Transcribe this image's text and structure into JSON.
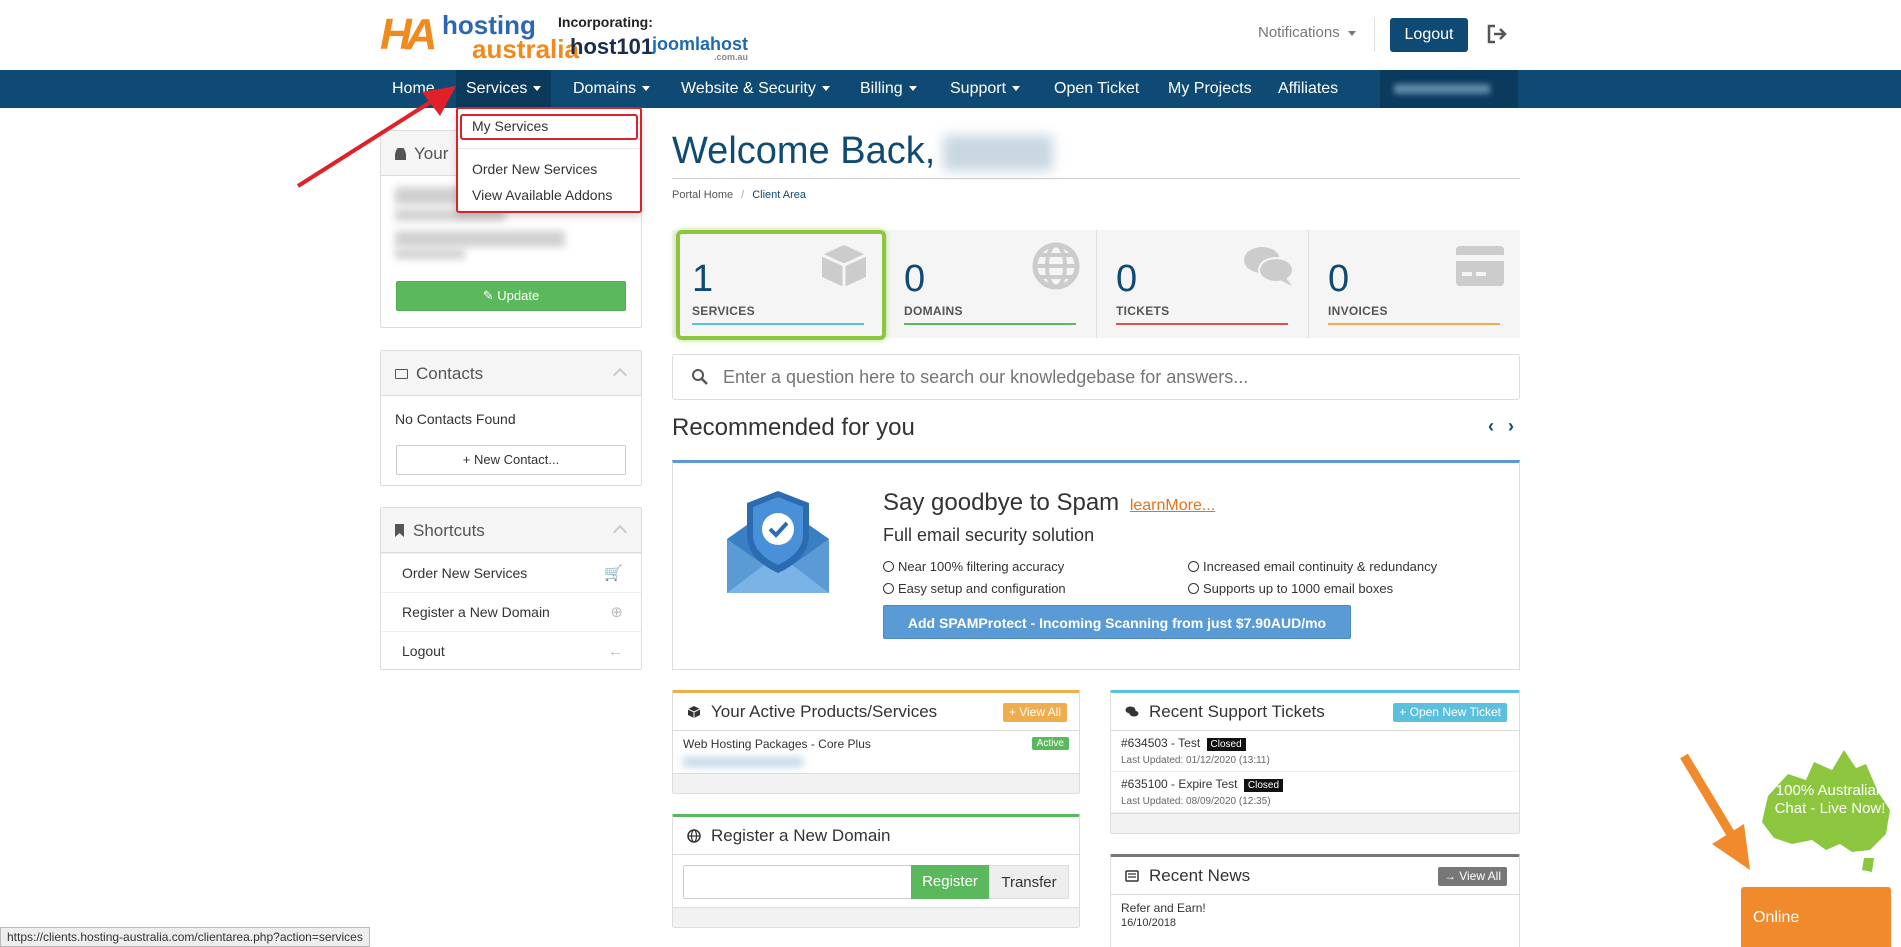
{
  "header": {
    "logo": {
      "ha": "HA",
      "hosting": "hosting",
      "australia": "australia",
      "incorporating": "Incorporating:",
      "host101": "host101",
      "joomlahost": "joomlahost",
      "joomla_suffix": ".com.au"
    },
    "notifications_label": "Notifications",
    "logout_label": "Logout"
  },
  "nav": {
    "items": [
      {
        "label": "Home"
      },
      {
        "label": "Services"
      },
      {
        "label": "Domains"
      },
      {
        "label": "Website & Security"
      },
      {
        "label": "Billing"
      },
      {
        "label": "Support"
      },
      {
        "label": "Open Ticket"
      },
      {
        "label": "My Projects"
      },
      {
        "label": "Affiliates"
      }
    ]
  },
  "services_dropdown": {
    "items": [
      {
        "label": "My Services"
      },
      {
        "label": "Order New Services"
      },
      {
        "label": "View Available Addons"
      }
    ]
  },
  "sidebar": {
    "your_info_title": "Your",
    "update_label": "Update",
    "contacts_title": "Contacts",
    "no_contacts": "No Contacts Found",
    "new_contact_label": "+ New Contact...",
    "shortcuts_title": "Shortcuts",
    "shortcuts": [
      {
        "label": "Order New Services",
        "icon": "cart-icon"
      },
      {
        "label": "Register a New Domain",
        "icon": "globe-icon"
      },
      {
        "label": "Logout",
        "icon": "arrow-left-icon"
      }
    ]
  },
  "main": {
    "welcome": "Welcome Back,",
    "breadcrumb": {
      "home": "Portal Home",
      "separator": "/",
      "current": "Client Area"
    },
    "tiles": [
      {
        "value": "1",
        "label": "SERVICES",
        "color": "#5bc0de",
        "icon": "cube-icon"
      },
      {
        "value": "0",
        "label": "DOMAINS",
        "color": "#5cb85c",
        "icon": "globe-icon"
      },
      {
        "value": "0",
        "label": "TICKETS",
        "color": "#d9534f",
        "icon": "comments-icon"
      },
      {
        "value": "0",
        "label": "INVOICES",
        "color": "#f0ad4e",
        "icon": "credit-card-icon"
      }
    ],
    "search_placeholder": "Enter a question here to search our knowledgebase for answers...",
    "recommended_title": "Recommended for you",
    "promo": {
      "title": "Say goodbye to Spam",
      "learn_more": "learnMore...",
      "subtitle": "Full email security solution",
      "features": [
        "Near 100% filtering accuracy",
        "Increased email continuity & redundancy",
        "Easy setup and configuration",
        "Supports up to 1000 email boxes"
      ],
      "button": "Add SPAMProtect - Incoming Scanning from just $7.90AUD/mo"
    },
    "products_panel": {
      "title": "Your Active Products/Services",
      "button": "View All",
      "item": "Web Hosting Packages - Core Plus",
      "status": "Active"
    },
    "tickets_panel": {
      "title": "Recent Support Tickets",
      "button": "Open New Ticket",
      "tickets": [
        {
          "title": "#634503 - Test",
          "status": "Closed",
          "updated": "Last Updated: 01/12/2020 (13:11)"
        },
        {
          "title": "#635100 - Expire Test",
          "status": "Closed",
          "updated": "Last Updated: 08/09/2020 (12:35)"
        }
      ]
    },
    "domain_panel": {
      "title": "Register a New Domain",
      "register": "Register",
      "transfer": "Transfer"
    },
    "news_panel": {
      "title": "Recent News",
      "button": "View All",
      "items": [
        {
          "title": "Refer and Earn!",
          "date": "16/10/2018"
        }
      ]
    }
  },
  "status_bar_url": "https://clients.hosting-australia.com/clientarea.php?action=services",
  "chat": {
    "line1": "100% Australian",
    "line2": "Chat - Live Now!",
    "status": "Online"
  },
  "colors": {
    "brand_navy": "#0e4a73",
    "accent_green": "#8cc63f",
    "annotation_red": "#d9232a",
    "chat_orange": "#f08a2c"
  }
}
